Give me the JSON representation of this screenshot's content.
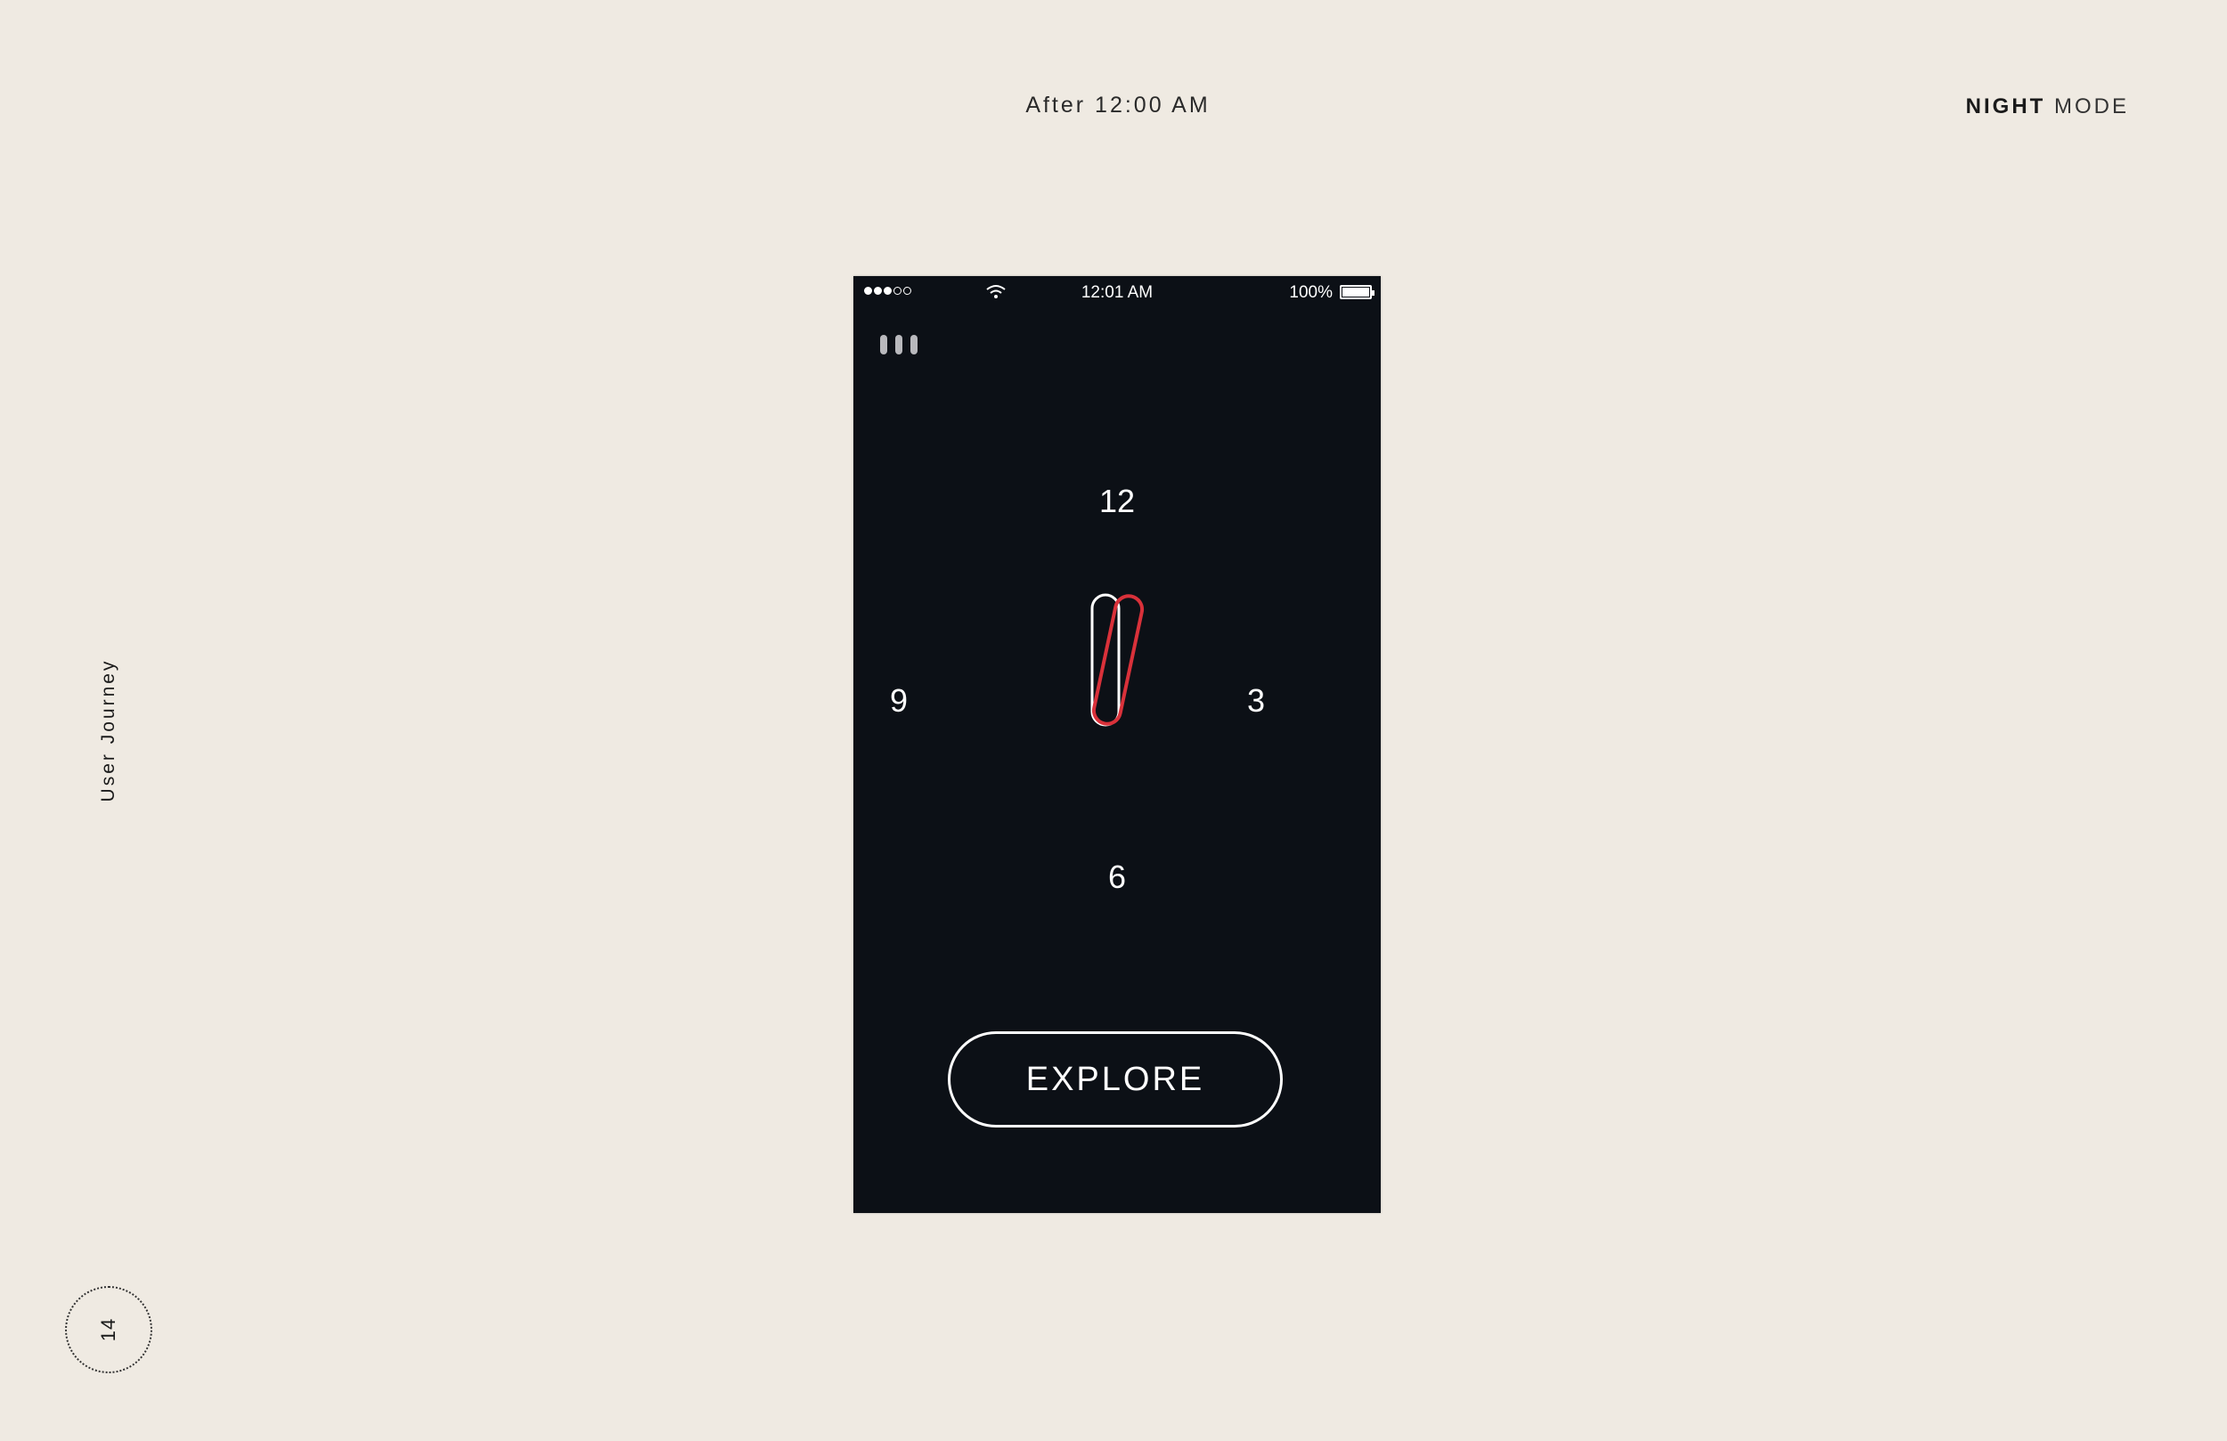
{
  "header": {
    "time_caption": "After 12:00 AM",
    "mode_strong": "NIGHT",
    "mode_light": "MODE"
  },
  "side": {
    "section_label": "User  Journey",
    "page_number": "14"
  },
  "phone": {
    "status_bar": {
      "signal_bars_filled": 3,
      "signal_bars_total": 5,
      "time": "12:01 AM",
      "battery": "100%",
      "icons": [
        "signal-dots-icon",
        "wifi-icon",
        "battery-icon"
      ]
    },
    "menu_icon": "menu-bars-icon",
    "dial": {
      "top": "12",
      "right": "3",
      "bottom": "6",
      "left": "9"
    },
    "explore_label": "EXPLORE"
  },
  "colors": {
    "page_bg": "#efeae2",
    "phone_bg": "#0c1016",
    "accent_red": "#d9313a",
    "text_dark": "#1a1a1a",
    "white": "#ffffff"
  }
}
